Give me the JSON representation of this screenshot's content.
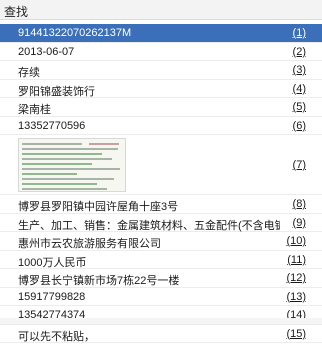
{
  "header": {
    "title": "查找"
  },
  "items": [
    {
      "text": "91441322070262137M",
      "num": "(1)"
    },
    {
      "text": "2013-06-07",
      "num": "(2)"
    },
    {
      "text": "存续",
      "num": "(3)"
    },
    {
      "text": "罗阳锦盛装饰行",
      "num": "(4)"
    },
    {
      "text": "梁南桂",
      "num": "(5)"
    },
    {
      "text": "13352770596",
      "num": "(6)"
    },
    {
      "text": "",
      "num": "(7)"
    },
    {
      "text": "博罗县罗阳镇中园许屋角十座3号",
      "num": "(8)"
    },
    {
      "text": "生产、加工、销售：金属建筑材料、五金配件(不含电镀...",
      "num": "(9)"
    },
    {
      "text": "惠州市云农旅游服务有限公司",
      "num": "(10)"
    },
    {
      "text": "1000万人民币",
      "num": "(11)"
    },
    {
      "text": "博罗县长宁镇新市场7栋22号一楼",
      "num": "(12)"
    },
    {
      "text": "15917799828",
      "num": "(13)"
    },
    {
      "text": "13542774374",
      "num": "(14)"
    },
    {
      "text": "可以先不粘贴，",
      "num": "(15)"
    }
  ]
}
